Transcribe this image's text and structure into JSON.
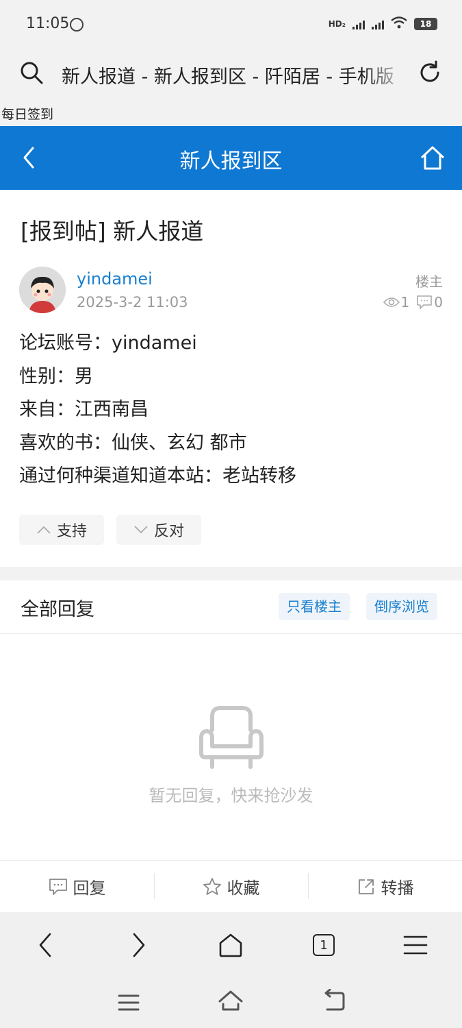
{
  "status": {
    "time": "11:05",
    "battery": "18"
  },
  "url_bar": {
    "text": "新人报道 - 新人报到区 - 阡陌居 - 手机版"
  },
  "checkin": {
    "label": "每日签到"
  },
  "header": {
    "title": "新人报到区",
    "accent_color": "#0f78d2"
  },
  "post": {
    "title": "[报到帖] 新人报道",
    "author": "yindamei",
    "date": "2025-3-2 11:03",
    "floor_label": "楼主",
    "views": "1",
    "comments": "0",
    "content": [
      "论坛账号：yindamei",
      "性别：男",
      "来自：江西南昌",
      "喜欢的书：仙侠、玄幻 都市",
      "通过何种渠道知道本站：老站转移"
    ],
    "support_label": "支持",
    "oppose_label": "反对"
  },
  "replies": {
    "title": "全部回复",
    "only_op_label": "只看楼主",
    "reverse_label": "倒序浏览",
    "empty_text": "暂无回复，快来抢沙发"
  },
  "actions": {
    "reply": "回复",
    "favorite": "收藏",
    "share": "转播"
  },
  "browser": {
    "tab_count": "1"
  }
}
